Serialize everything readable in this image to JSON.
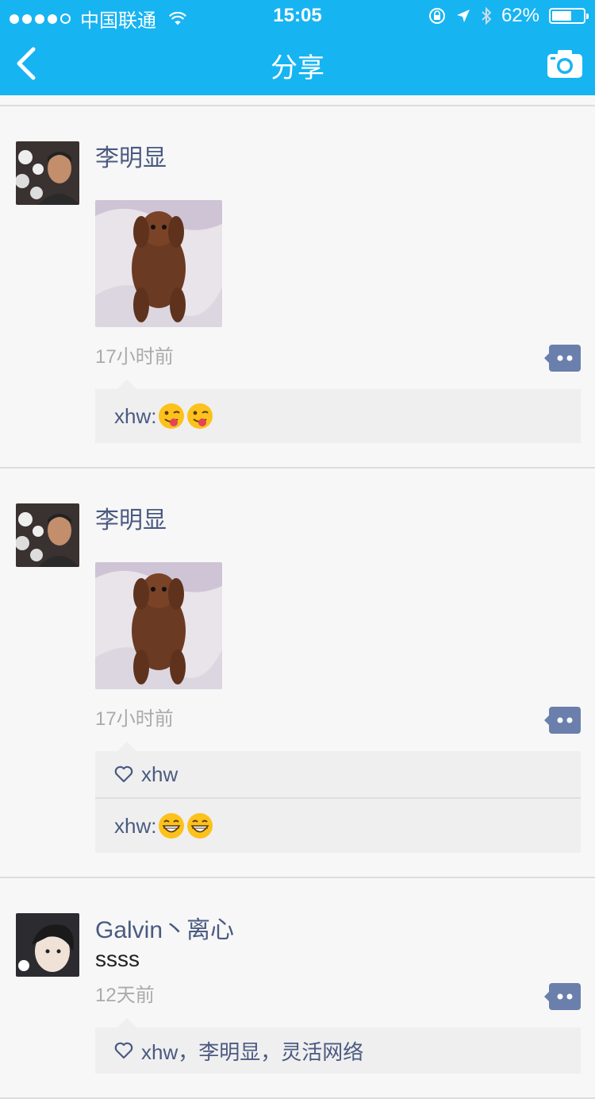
{
  "status_bar": {
    "carrier": "中国联通",
    "time": "15:05",
    "battery_percent": "62%",
    "battery_level": 0.62
  },
  "nav": {
    "title": "分享",
    "back_icon": "chevron-left-icon",
    "camera_icon": "camera-icon"
  },
  "colors": {
    "nav_bg": "#17b4f2",
    "username": "#4a5a80",
    "timestamp": "#aaaaaa",
    "comment_box": "#efefef"
  },
  "posts": [
    {
      "username": "李明显",
      "time": "17小时前",
      "comments": [
        {
          "author": "xhw:",
          "emoji": [
            "winking-tongue-emoji",
            "winking-tongue-emoji"
          ]
        }
      ]
    },
    {
      "username": "李明显",
      "time": "17小时前",
      "likes": "xhw",
      "comments": [
        {
          "author": "xhw:",
          "emoji": [
            "grinning-emoji",
            "grinning-emoji"
          ]
        }
      ]
    },
    {
      "username": "Galvin丶离心",
      "text": "ssss",
      "time": "12天前",
      "likes": "xhw，李明显，灵活网络"
    }
  ]
}
